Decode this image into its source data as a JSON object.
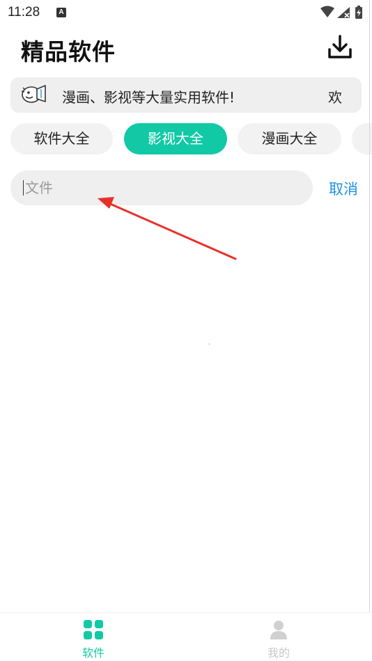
{
  "status_bar": {
    "time": "11:28",
    "notification_icon": "A"
  },
  "header": {
    "title": "精品软件",
    "download_icon": "download-icon"
  },
  "notice": {
    "icon": "megaphone-icon",
    "text": "漫画、影视等大量实用软件!",
    "overflow_text": "欢"
  },
  "tabs": [
    {
      "label": "软件大全",
      "active": false
    },
    {
      "label": "影视大全",
      "active": true
    },
    {
      "label": "漫画大全",
      "active": false
    },
    {
      "label": "",
      "active": false
    }
  ],
  "search": {
    "value": "",
    "placeholder": "文件",
    "cancel_label": "取消"
  },
  "bottom_nav": [
    {
      "label": "软件",
      "icon": "grid-icon",
      "active": true
    },
    {
      "label": "我的",
      "icon": "user-icon",
      "active": false
    }
  ],
  "colors": {
    "accent": "#12c9a6",
    "link": "#1e90e8",
    "annotation_arrow": "#e8302a"
  }
}
